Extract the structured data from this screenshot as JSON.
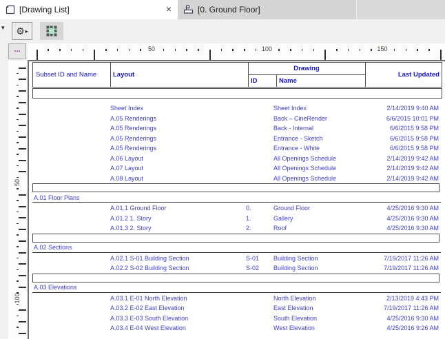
{
  "tabs": [
    {
      "label": "[Drawing List]",
      "icon": "document-icon",
      "active": true,
      "closable": true
    },
    {
      "label": "[0. Ground Floor]",
      "icon": "floor-plan-icon",
      "active": false
    }
  ],
  "icons": {
    "close": "×",
    "overflow": "...",
    "dropdown": "▾",
    "flyout": "▸",
    "gear": "⚙"
  },
  "colors": {
    "header_blue": "#1515cc",
    "data_blue": "#4040d2",
    "marquee_green": "#aee6c6",
    "ruler_label": "#3f3f33"
  },
  "rulers": {
    "horizontal": [
      {
        "pos": 50,
        "label": "50"
      },
      {
        "pos": 100,
        "label": "100"
      },
      {
        "pos": 150,
        "label": "150"
      }
    ],
    "vertical": [
      {
        "pos": 50,
        "label": "50"
      },
      {
        "pos": 100,
        "label": "100"
      }
    ]
  },
  "table": {
    "header": {
      "subset": "Subset ID and Name",
      "layout": "Layout",
      "drawing": "Drawing",
      "id": "ID",
      "name": "Name",
      "last_updated": "Last Updated"
    },
    "rows": [
      {
        "type": "item",
        "layout": "Sheet Index",
        "id": "",
        "name": "Sheet Index",
        "updated": "2/14/2019 9:40 AM"
      },
      {
        "type": "item",
        "layout": "A.05 Renderings",
        "id": "",
        "name": "Back – CineRender",
        "updated": "6/6/2015 10:01 PM"
      },
      {
        "type": "item",
        "layout": "A.05 Renderings",
        "id": "",
        "name": "Back - Internal",
        "updated": "6/6/2015 9:58 PM"
      },
      {
        "type": "item",
        "layout": "A.05 Renderings",
        "id": "",
        "name": "Entrance - Sketch",
        "updated": "6/6/2015 9:58 PM"
      },
      {
        "type": "item",
        "layout": "A.05 Renderings",
        "id": "",
        "name": "Entrance - White",
        "updated": "6/6/2015 9:58 PM"
      },
      {
        "type": "item",
        "layout": "A.06 Layout",
        "id": "",
        "name": "All Openings Schedule",
        "updated": "2/14/2019 9:42 AM"
      },
      {
        "type": "item",
        "layout": "A.07 Layout",
        "id": "",
        "name": "All Openings Schedule",
        "updated": "2/14/2019 9:42 AM"
      },
      {
        "type": "item",
        "layout": "A.08 Layout",
        "id": "",
        "name": "All Openings Schedule",
        "updated": "2/14/2019 9:42 AM"
      },
      {
        "type": "separator"
      },
      {
        "type": "section",
        "title": "A.01 Floor Plans"
      },
      {
        "type": "item",
        "layout": "A.01.1 Ground Floor",
        "id": "0.",
        "name": "Ground Floor",
        "updated": "4/25/2016 9:30 AM"
      },
      {
        "type": "item",
        "layout": "A.01.2 1. Story",
        "id": "1.",
        "name": "Gallery",
        "updated": "4/25/2016 9:30 AM"
      },
      {
        "type": "item",
        "layout": "A.01.3 2. Story",
        "id": "2.",
        "name": "Roof",
        "updated": "4/25/2016 9:30 AM"
      },
      {
        "type": "separator"
      },
      {
        "type": "section",
        "title": "A.02 Sections"
      },
      {
        "type": "item",
        "layout": "A.02.1 S-01 Building Section",
        "id": "S-01",
        "name": "Building Section",
        "updated": "7/19/2017 11:26 AM"
      },
      {
        "type": "item",
        "layout": "A.02.2 S-02 Building Section",
        "id": "S-02",
        "name": "Building Section",
        "updated": "7/19/2017 11:26 AM"
      },
      {
        "type": "separator"
      },
      {
        "type": "section",
        "title": "A.03 Elevations"
      },
      {
        "type": "item",
        "layout": "A.03.1 E-01 North Elevation",
        "id": "",
        "name": "North Elevation",
        "updated": "2/13/2019 4:43 PM"
      },
      {
        "type": "item",
        "layout": "A.03.2 E-02 East Elevation",
        "id": "",
        "name": "East Elevation",
        "updated": "7/19/2017 11:26 AM"
      },
      {
        "type": "item",
        "layout": "A.03.3 E-03 South Elevation",
        "id": "",
        "name": "South Elevation",
        "updated": "4/25/2016 9:30 AM"
      },
      {
        "type": "item",
        "layout": "A.03.4 E-04 West Elevation",
        "id": "",
        "name": "West Elevation",
        "updated": "4/25/2016 9:26 AM"
      }
    ]
  }
}
